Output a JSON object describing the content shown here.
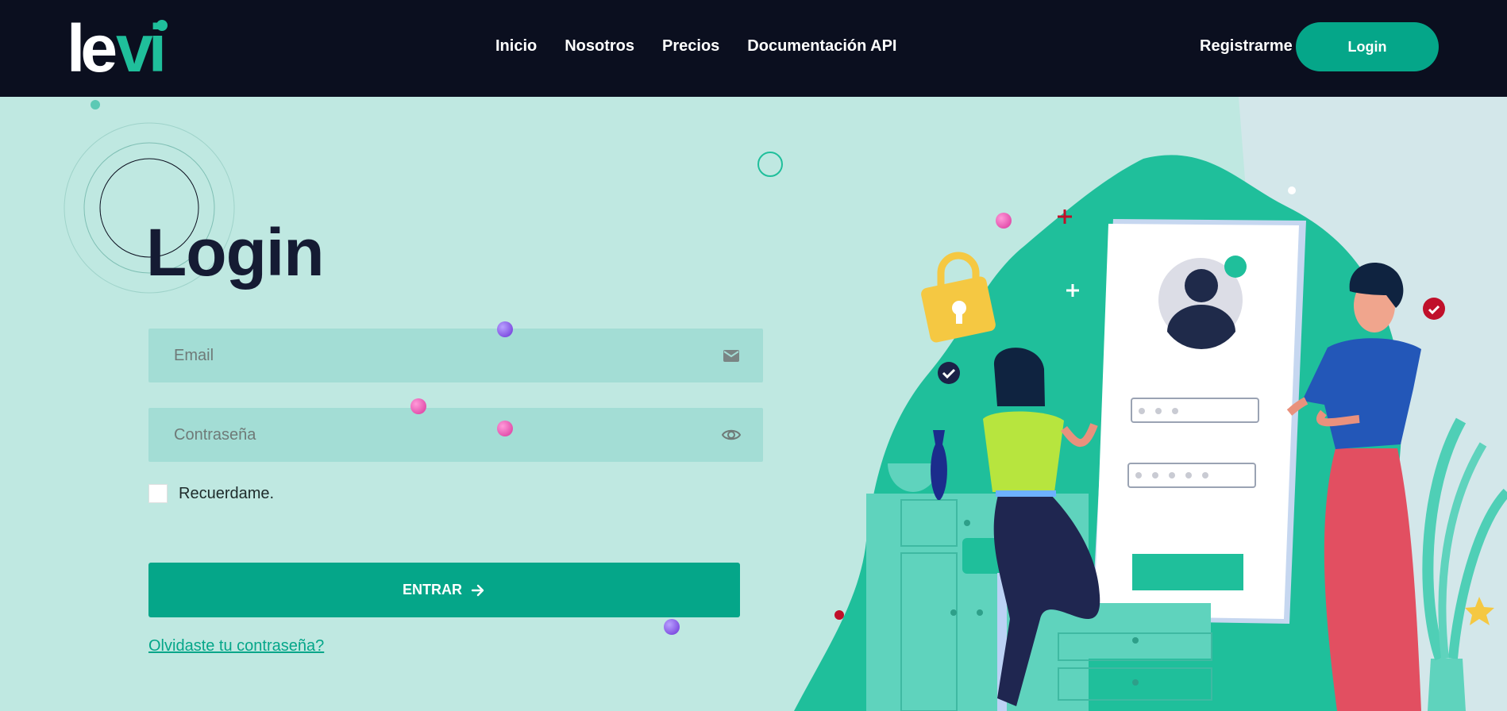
{
  "brand": {
    "name": "levi",
    "colors": {
      "dark": "#0b0f1f",
      "accent": "#05a689",
      "background": "#bfe8e1",
      "field": "#a3ddd5"
    }
  },
  "nav": {
    "items": [
      {
        "label": "Inicio"
      },
      {
        "label": "Nosotros"
      },
      {
        "label": "Precios"
      },
      {
        "label": "Documentación API"
      }
    ],
    "register_label": "Registrarme",
    "login_label": "Login"
  },
  "main": {
    "title": "Login",
    "email": {
      "placeholder": "Email",
      "value": "",
      "icon": "envelope-icon"
    },
    "password": {
      "placeholder": "Contraseña",
      "value": "",
      "icon": "eye-icon"
    },
    "remember_label": "Recuerdame.",
    "remember_checked": false,
    "submit_label": "ENTRAR",
    "submit_icon": "arrow-right-icon",
    "forgot_label": "Olvidaste tu contraseña?"
  }
}
